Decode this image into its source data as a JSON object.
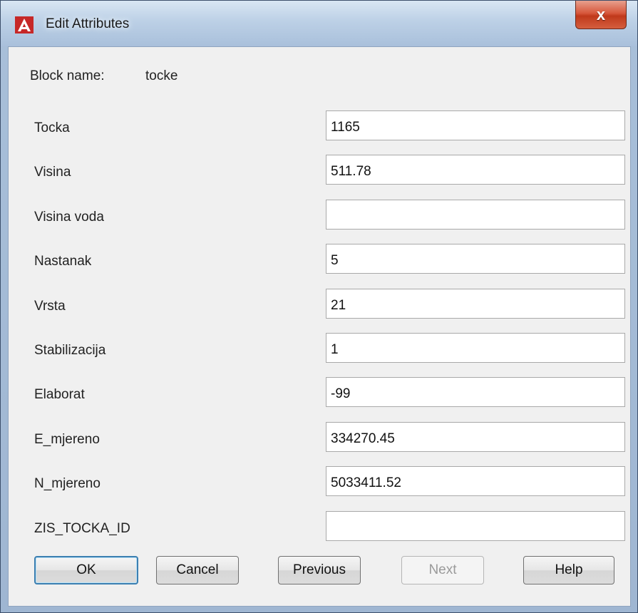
{
  "window": {
    "title": "Edit Attributes",
    "close_label": "x",
    "app_icon": "autocad-icon"
  },
  "block": {
    "label": "Block name:",
    "value": "tocke"
  },
  "attributes": [
    {
      "label": "Tocka",
      "value": "1165"
    },
    {
      "label": "Visina",
      "value": "511.78"
    },
    {
      "label": "Visina voda",
      "value": ""
    },
    {
      "label": "Nastanak",
      "value": "5"
    },
    {
      "label": "Vrsta",
      "value": "21"
    },
    {
      "label": "Stabilizacija",
      "value": "1"
    },
    {
      "label": "Elaborat",
      "value": "-99"
    },
    {
      "label": "E_mjereno",
      "value": "334270.45"
    },
    {
      "label": "N_mjereno",
      "value": "5033411.52"
    },
    {
      "label": "ZIS_TOCKA_ID",
      "value": ""
    }
  ],
  "buttons": {
    "ok": "OK",
    "cancel": "Cancel",
    "previous": "Previous",
    "next": "Next",
    "help": "Help"
  },
  "colors": {
    "titlebar": "#bcd0e6",
    "close_button": "#c0391b",
    "client_bg": "#f0f0f0",
    "default_button_border": "#3c7fb1"
  }
}
